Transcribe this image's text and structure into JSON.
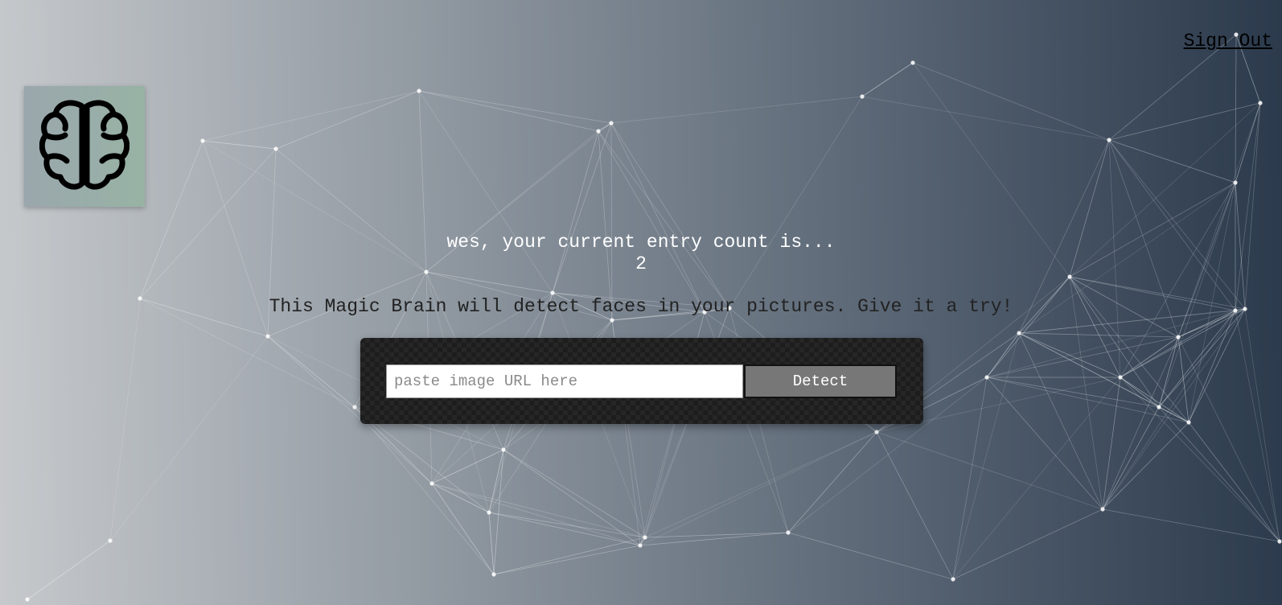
{
  "nav": {
    "sign_out_label": "Sign Out"
  },
  "logo": {
    "icon": "brain-icon",
    "background_colors": [
      "#9aa7ad",
      "#98b3a4"
    ]
  },
  "rank": {
    "message": "wes, your current entry count is...",
    "count": "2"
  },
  "tagline": "This Magic Brain will detect faces in your pictures. Give it a try!",
  "form": {
    "url_input": {
      "placeholder": "paste image URL here",
      "value": ""
    },
    "detect_label": "Detect"
  },
  "theme": {
    "gradient_start": "#c6c9cc",
    "gradient_end": "#2b3a4c",
    "button_color": "#777777",
    "panel_color": "#1d1d1d"
  }
}
